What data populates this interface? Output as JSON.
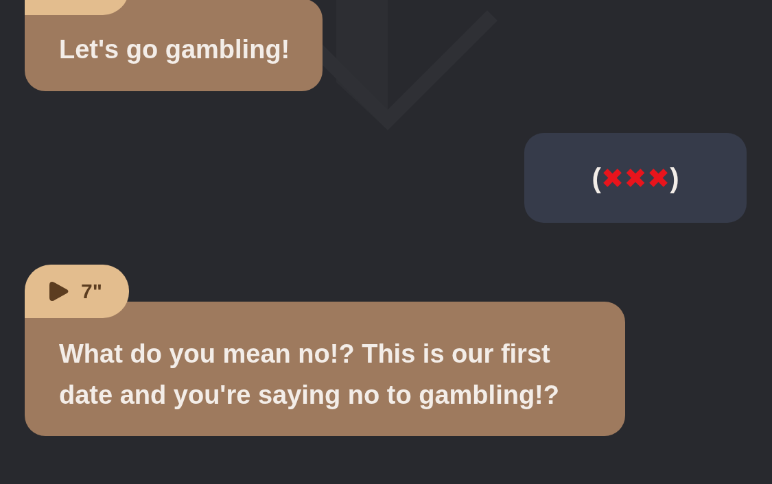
{
  "messages": [
    {
      "kind": "incoming",
      "voice_tab": true,
      "text": "Let's go gambling!"
    },
    {
      "kind": "outgoing",
      "voice_tab": false,
      "parts": [
        {
          "kind": "plain",
          "text": "("
        },
        {
          "kind": "mark",
          "text": "✖✖✖"
        },
        {
          "kind": "plain",
          "text": ")"
        }
      ]
    },
    {
      "kind": "incoming",
      "voice_tab": true,
      "duration": "7\"",
      "text": "What do you mean no!? This is our first date and you're saying no to gambling!?"
    }
  ]
}
